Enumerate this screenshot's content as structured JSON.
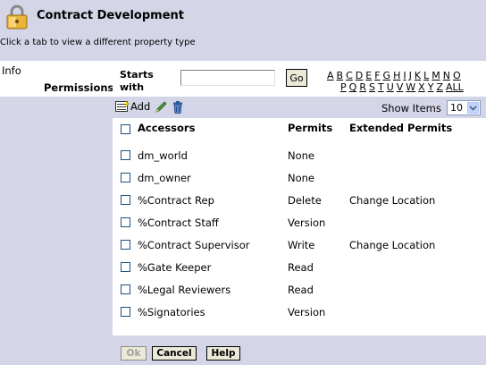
{
  "header": {
    "title": "Contract Development",
    "subtitle": "Click a tab to view a different property type"
  },
  "tabs": [
    {
      "label": "Info",
      "active": false
    },
    {
      "label": "Permissions",
      "active": true
    }
  ],
  "filter": {
    "starts_with_label": "Starts with",
    "input_value": "",
    "go_label": "Go",
    "letters_row1": [
      "A",
      "B",
      "C",
      "D",
      "E",
      "F",
      "G",
      "H",
      "I",
      "J",
      "K",
      "L",
      "M",
      "N",
      "O"
    ],
    "letters_row2": [
      "P",
      "Q",
      "R",
      "S",
      "T",
      "U",
      "V",
      "W",
      "X",
      "Y",
      "Z",
      "ALL"
    ]
  },
  "toolbar": {
    "add_label": "Add",
    "show_items_label": "Show Items",
    "show_items_value": "10"
  },
  "table": {
    "columns": [
      "Accessors",
      "Permits",
      "Extended Permits"
    ],
    "rows": [
      {
        "accessor": "dm_world",
        "permit": "None",
        "extended": ""
      },
      {
        "accessor": "dm_owner",
        "permit": "None",
        "extended": ""
      },
      {
        "accessor": "%Contract Rep",
        "permit": "Delete",
        "extended": "Change Location"
      },
      {
        "accessor": "%Contract Staff",
        "permit": "Version",
        "extended": ""
      },
      {
        "accessor": "%Contract Supervisor",
        "permit": "Write",
        "extended": "Change Location"
      },
      {
        "accessor": "%Gate Keeper",
        "permit": "Read",
        "extended": ""
      },
      {
        "accessor": "%Legal Reviewers",
        "permit": "Read",
        "extended": ""
      },
      {
        "accessor": "%Signatories",
        "permit": "Version",
        "extended": ""
      }
    ]
  },
  "footer": {
    "ok_label": "Ok",
    "cancel_label": "Cancel",
    "help_label": "Help"
  },
  "icons": {
    "header": "lock-icon",
    "add": "add-icon",
    "edit": "pencil-icon",
    "delete": "trash-icon"
  }
}
